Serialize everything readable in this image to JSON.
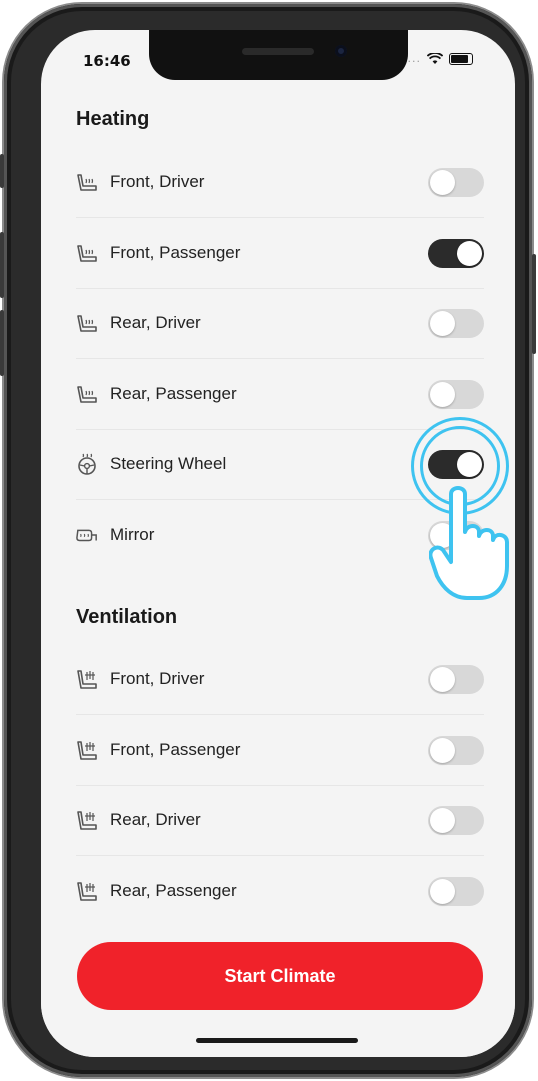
{
  "status": {
    "time": "16:46",
    "signal": "...."
  },
  "heating": {
    "title": "Heating",
    "items": [
      {
        "label": "Front, Driver",
        "icon": "seat-heat-icon",
        "on": false
      },
      {
        "label": "Front, Passenger",
        "icon": "seat-heat-icon",
        "on": true
      },
      {
        "label": "Rear, Driver",
        "icon": "seat-heat-icon",
        "on": false
      },
      {
        "label": "Rear, Passenger",
        "icon": "seat-heat-icon",
        "on": false
      },
      {
        "label": "Steering Wheel",
        "icon": "steering-wheel-heat-icon",
        "on": true
      },
      {
        "label": "Mirror",
        "icon": "mirror-heat-icon",
        "on": false
      }
    ]
  },
  "ventilation": {
    "title": "Ventilation",
    "items": [
      {
        "label": "Front, Driver",
        "icon": "seat-vent-icon",
        "on": false
      },
      {
        "label": "Front, Passenger",
        "icon": "seat-vent-icon",
        "on": false
      },
      {
        "label": "Rear, Driver",
        "icon": "seat-vent-icon",
        "on": false
      },
      {
        "label": "Rear, Passenger",
        "icon": "seat-vent-icon",
        "on": false
      }
    ]
  },
  "actions": {
    "start_label": "Start Climate"
  },
  "colors": {
    "accent": "#f0222a",
    "toggle_on": "#2b2b2b",
    "toggle_off": "#d8d8d8",
    "tap_highlight": "#3ec3f0"
  }
}
